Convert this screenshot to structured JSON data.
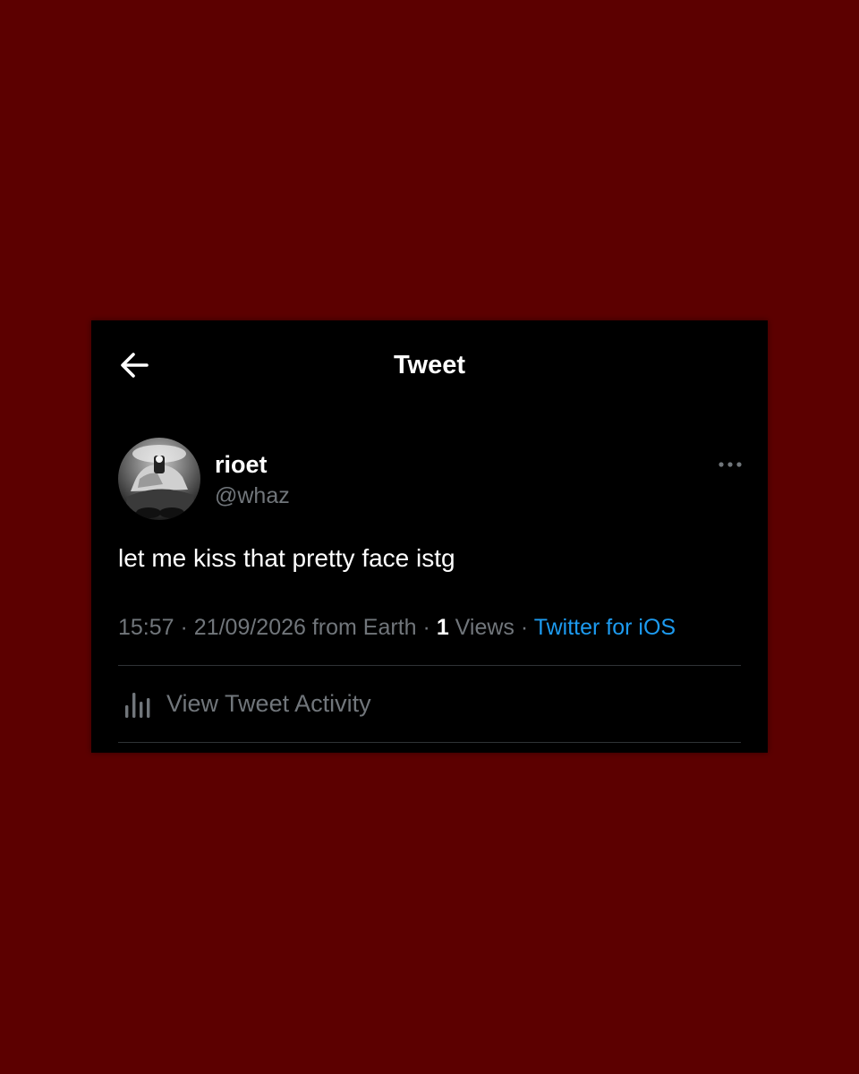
{
  "header": {
    "title": "Tweet",
    "back_icon": "arrow-left-icon"
  },
  "author": {
    "display_name": "rioet",
    "handle": "@whaz",
    "avatar": "profile-photo"
  },
  "tweet": {
    "text": "let me kiss that pretty face istg",
    "time": "15:57",
    "separator": "·",
    "date_location": "21/09/2026 from Earth",
    "views_count": "1",
    "views_label": "Views",
    "source": "Twitter for iOS"
  },
  "more_icon": "more-horizontal-icon",
  "activity": {
    "icon": "bar-chart-icon",
    "label": "View Tweet Activity"
  },
  "colors": {
    "page_background": "#5c0000",
    "card_background": "#000000",
    "primary_text": "#ffffff",
    "secondary_text": "#71767b",
    "link": "#1d9bf0",
    "divider": "#2f3336"
  }
}
